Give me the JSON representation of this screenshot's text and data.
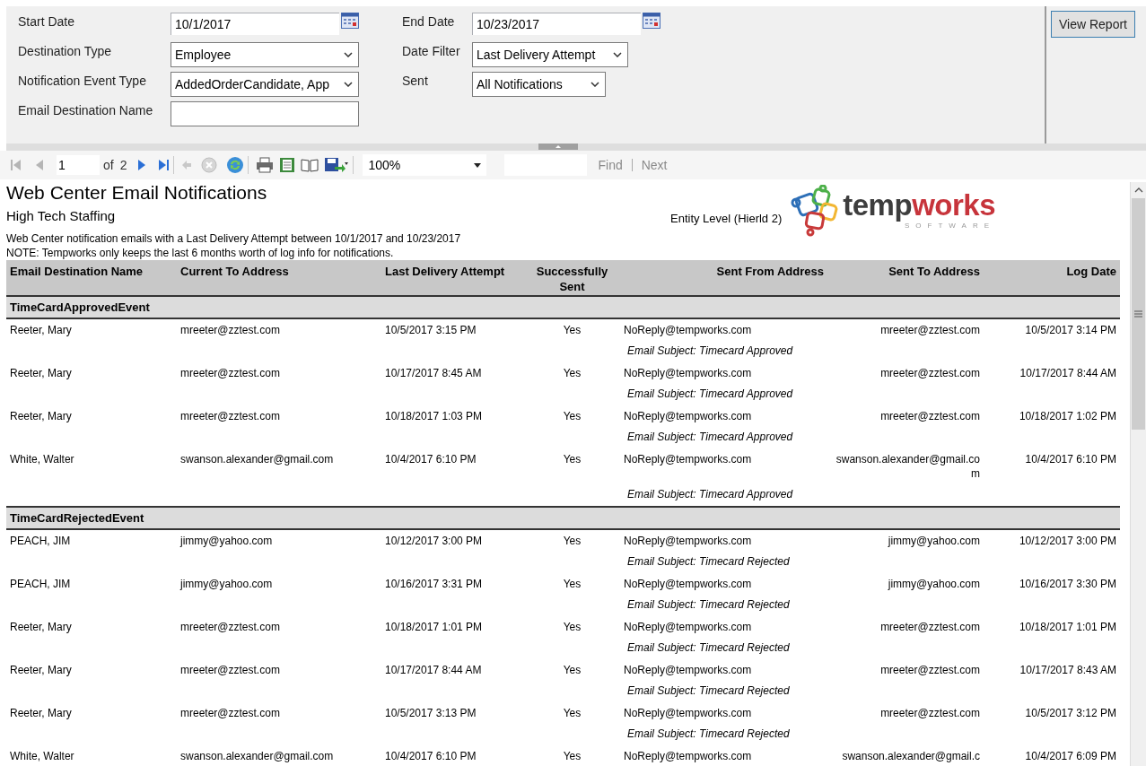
{
  "parameters": {
    "left": [
      {
        "label": "Start Date",
        "kind": "date",
        "value": "10/1/2017"
      },
      {
        "label": "Destination Type",
        "kind": "select",
        "value": "Employee"
      },
      {
        "label": "Notification Event Type",
        "kind": "select",
        "value": "AddedOrderCandidate, App"
      },
      {
        "label": "Email Destination Name",
        "kind": "text"
      }
    ],
    "right": [
      {
        "label": "End Date",
        "kind": "date",
        "value": "10/23/2017"
      },
      {
        "label": "Date Filter",
        "kind": "select",
        "value": "Last Delivery Attempt"
      },
      {
        "label": "Sent",
        "kind": "select",
        "value": "All Notifications"
      }
    ],
    "view_button": "View Report"
  },
  "toolbar": {
    "nav": [
      {
        "kind": "first",
        "disabled": true
      },
      {
        "kind": "prev",
        "disabled": true
      }
    ],
    "page": "1",
    "of": "of",
    "total": "2",
    "tools": [
      {
        "kind": "next",
        "disabled": false
      },
      {
        "kind": "last",
        "disabled": false
      },
      {
        "kind": "back",
        "disabled": true
      },
      {
        "kind": "stop",
        "disabled": true
      },
      {
        "kind": "refresh",
        "disabled": false
      },
      {
        "kind": "print",
        "disabled": false
      },
      {
        "kind": "layout",
        "disabled": false
      },
      {
        "kind": "page_setup",
        "disabled": false
      },
      {
        "kind": "export",
        "disabled": false
      }
    ],
    "zoom": "100%",
    "find": {
      "label": "Find",
      "disabled": true
    },
    "next": {
      "label": "Next",
      "disabled": true
    }
  },
  "report": {
    "title": "Web Center Email Notifications",
    "subtitle": "High Tech Staffing",
    "entity": "Entity Level (Hierld 2)",
    "logo": {
      "dark": "temp",
      "accent": "works",
      "tagline": "SOFTWARE"
    },
    "description": "Web Center notification emails with a Last Delivery Attempt between 10/1/2017 and 10/23/2017",
    "note": "NOTE: Tempworks only keeps the last 6 months worth of log info for notifications.",
    "columns": [
      "Email Destination Name",
      "Current To Address",
      "Last Delivery Attempt",
      "Successfully Sent",
      "Sent From Address",
      "Sent To Address",
      "Log Date"
    ],
    "groups": [
      {
        "name": "TimeCardApprovedEvent",
        "records": [
          {
            "name": "Reeter, Mary",
            "current_to": "mreeter@zztest.com",
            "last_attempt": "10/5/2017 3:15 PM",
            "sent": "Yes",
            "from": "NoReply@tempworks.com",
            "to": "mreeter@zztest.com",
            "log_date": "10/5/2017 3:14 PM",
            "subject": "Email Subject: Timecard Approved"
          },
          {
            "name": "Reeter, Mary",
            "current_to": "mreeter@zztest.com",
            "last_attempt": "10/17/2017 8:45 AM",
            "sent": "Yes",
            "from": "NoReply@tempworks.com",
            "to": "mreeter@zztest.com",
            "log_date": "10/17/2017 8:44 AM",
            "subject": "Email Subject: Timecard Approved"
          },
          {
            "name": "Reeter, Mary",
            "current_to": "mreeter@zztest.com",
            "last_attempt": "10/18/2017 1:03 PM",
            "sent": "Yes",
            "from": "NoReply@tempworks.com",
            "to": "mreeter@zztest.com",
            "log_date": "10/18/2017 1:02 PM",
            "subject": "Email Subject: Timecard Approved"
          },
          {
            "name": "White, Walter",
            "current_to": "swanson.alexander@gmail.com",
            "last_attempt": "10/4/2017 6:10 PM",
            "sent": "Yes",
            "from": "NoReply@tempworks.com",
            "to": "swanson.alexander@gmail.com",
            "log_date": "10/4/2017 6:10 PM",
            "subject": "Email Subject: Timecard Approved"
          }
        ]
      },
      {
        "name": "TimeCardRejectedEvent",
        "records": [
          {
            "name": "PEACH, JIM",
            "current_to": "jimmy@yahoo.com",
            "last_attempt": "10/12/2017 3:00 PM",
            "sent": "Yes",
            "from": "NoReply@tempworks.com",
            "to": "jimmy@yahoo.com",
            "log_date": "10/12/2017 3:00 PM",
            "subject": "Email Subject: Timecard Rejected"
          },
          {
            "name": "PEACH, JIM",
            "current_to": "jimmy@yahoo.com",
            "last_attempt": "10/16/2017 3:31 PM",
            "sent": "Yes",
            "from": "NoReply@tempworks.com",
            "to": "jimmy@yahoo.com",
            "log_date": "10/16/2017 3:30 PM",
            "subject": "Email Subject: Timecard Rejected"
          },
          {
            "name": "Reeter, Mary",
            "current_to": "mreeter@zztest.com",
            "last_attempt": "10/18/2017 1:01 PM",
            "sent": "Yes",
            "from": "NoReply@tempworks.com",
            "to": "mreeter@zztest.com",
            "log_date": "10/18/2017 1:01 PM",
            "subject": "Email Subject: Timecard Rejected"
          },
          {
            "name": "Reeter, Mary",
            "current_to": "mreeter@zztest.com",
            "last_attempt": "10/17/2017 8:44 AM",
            "sent": "Yes",
            "from": "NoReply@tempworks.com",
            "to": "mreeter@zztest.com",
            "log_date": "10/17/2017 8:43 AM",
            "subject": "Email Subject: Timecard Rejected"
          },
          {
            "name": "Reeter, Mary",
            "current_to": "mreeter@zztest.com",
            "last_attempt": "10/5/2017 3:13 PM",
            "sent": "Yes",
            "from": "NoReply@tempworks.com",
            "to": "mreeter@zztest.com",
            "log_date": "10/5/2017 3:12 PM",
            "subject": "Email Subject: Timecard Rejected"
          },
          {
            "name": "White, Walter",
            "current_to": "swanson.alexander@gmail.com",
            "last_attempt": "10/4/2017 6:10 PM",
            "sent": "Yes",
            "from": "NoReply@tempworks.com",
            "to": "swanson.alexander@gmail.c",
            "log_date": "10/4/2017 6:09 PM"
          }
        ]
      }
    ]
  }
}
